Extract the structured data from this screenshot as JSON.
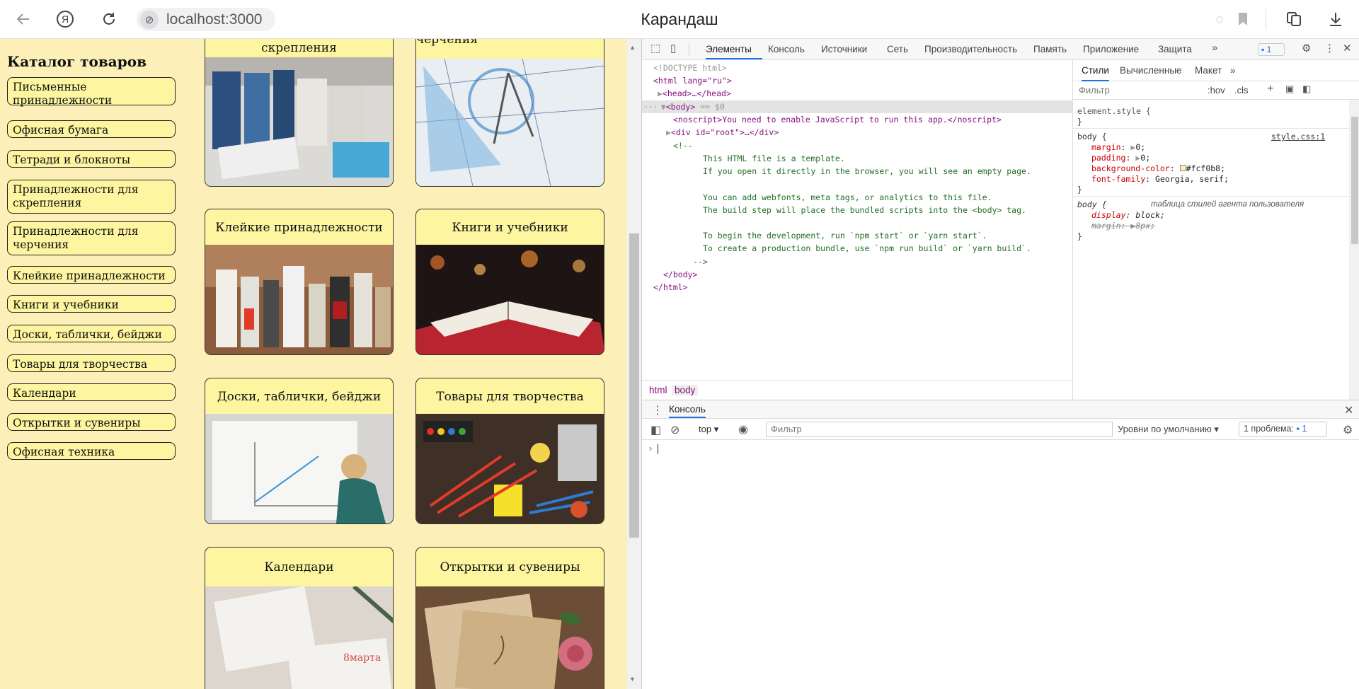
{
  "browser": {
    "url": "localhost:3000",
    "title": "Карандаш"
  },
  "site": {
    "catalog_title": "Каталог товаров",
    "categories": [
      "Письменные принадлежности",
      "Офисная бумага",
      "Тетради и блокноты",
      "Принадлежности для скрепления",
      "Принадлежности для черчения",
      "Клейкие принадлежности",
      "Книги и учебники",
      "Доски, таблички, бейджи",
      "Товары для творчества",
      "Календари",
      "Открытки и сувениры",
      "Офисная техника"
    ],
    "cards": [
      {
        "title": "скрепления"
      },
      {
        "title": "Принадлежности для черчения"
      },
      {
        "title": "Клейкие принадлежности"
      },
      {
        "title": "Книги и учебники"
      },
      {
        "title": "Доски, таблички, бейджи"
      },
      {
        "title": "Товары для творчества"
      },
      {
        "title": "Календари"
      },
      {
        "title": "Открытки и сувениры"
      }
    ],
    "bg_color": "#fcf0b8"
  },
  "devtools": {
    "tabs": [
      "Элементы",
      "Консоль",
      "Источники",
      "Сеть",
      "Производительность",
      "Память",
      "Приложение",
      "Защита"
    ],
    "issues_badge": "1",
    "dom": {
      "doctype": "<!DOCTYPE html>",
      "html_open": "<html lang=\"ru\">",
      "head": "<head>…</head>",
      "body_open": "<body>",
      "body_marker": "== $0",
      "noscript": "<noscript>You need to enable JavaScript to run this app.</noscript>",
      "root_div": "<div id=\"root\">…</div>",
      "comment_open": "<!--",
      "comment_lines": [
        "This HTML file is a template.",
        "If you open it directly in the browser, you will see an empty page.",
        "",
        "You can add webfonts, meta tags, or analytics to this file.",
        "The build step will place the bundled scripts into the <body> tag.",
        "",
        "To begin the development, run `npm start` or `yarn start`.",
        "To create a production bundle, use `npm run build` or `yarn build`."
      ],
      "comment_close": "-->",
      "body_close": "</body>",
      "html_close": "</html>"
    },
    "breadcrumbs": [
      "html",
      "body"
    ],
    "styles_tabs": [
      "Стили",
      "Вычисленные",
      "Макет"
    ],
    "styles_filter_placeholder": "Фильтр",
    "styles_hov": ":hov",
    "styles_cls": ".cls",
    "element_style": "element.style {",
    "body_rule_source": "style.css:1",
    "body_rule": [
      {
        "prop": "margin",
        "value": "0;"
      },
      {
        "prop": "padding",
        "value": "0;"
      },
      {
        "prop": "background-color",
        "value": "#fcf0b8;"
      },
      {
        "prop": "font-family",
        "value": "Georgia, serif;"
      }
    ],
    "ua_rule_source": "таблица стилей агента пользователя",
    "ua_rule": [
      {
        "prop": "display",
        "value": "block;"
      },
      {
        "prop": "margin",
        "value": "8px;"
      }
    ],
    "drawer_tab": "Консоль",
    "console_context": "top",
    "console_filter_placeholder": "Фильтр",
    "console_levels": "Уровни по умолчанию",
    "console_issues": "1 проблема:",
    "console_issues_count": "1"
  }
}
